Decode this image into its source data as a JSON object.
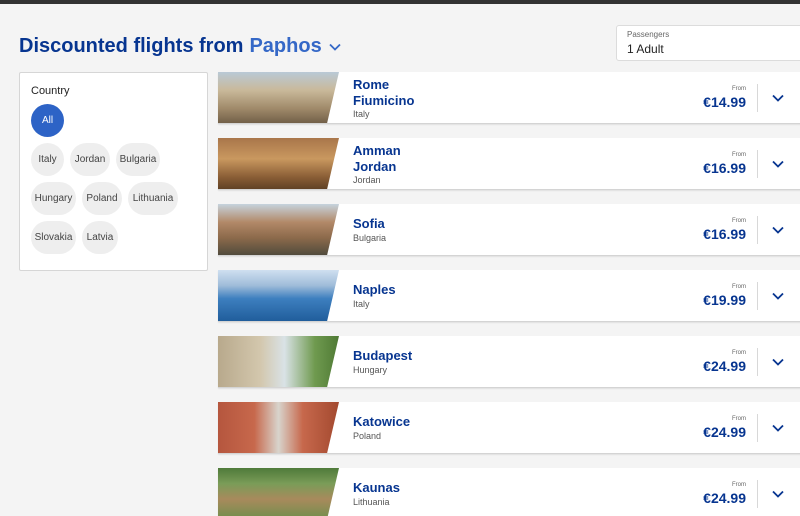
{
  "header": {
    "title": "Discounted flights from",
    "origin": "Paphos"
  },
  "passengers": {
    "label": "Passengers",
    "value": "1 Adult"
  },
  "filter": {
    "heading": "Country",
    "chips": [
      "All",
      "Italy",
      "Jordan",
      "Bulgaria",
      "Hungary",
      "Poland",
      "Lithuania",
      "Slovakia",
      "Latvia"
    ],
    "selected": "All"
  },
  "destinations": [
    {
      "city_line1": "Rome",
      "city_line2": "Fiumicino",
      "country": "Italy",
      "from": "From",
      "price": "€14.99"
    },
    {
      "city_line1": "Amman",
      "city_line2": "Jordan",
      "country": "Jordan",
      "from": "From",
      "price": "€16.99"
    },
    {
      "city_line1": "Sofia",
      "city_line2": "",
      "country": "Bulgaria",
      "from": "From",
      "price": "€16.99"
    },
    {
      "city_line1": "Naples",
      "city_line2": "",
      "country": "Italy",
      "from": "From",
      "price": "€19.99"
    },
    {
      "city_line1": "Budapest",
      "city_line2": "",
      "country": "Hungary",
      "from": "From",
      "price": "€24.99"
    },
    {
      "city_line1": "Katowice",
      "city_line2": "",
      "country": "Poland",
      "from": "From",
      "price": "€24.99"
    },
    {
      "city_line1": "Kaunas",
      "city_line2": "",
      "country": "Lithuania",
      "from": "From",
      "price": "€24.99"
    }
  ],
  "icons": {
    "origin_dropdown": "chevron-down-icon",
    "card_expand": "chevron-down-icon"
  },
  "colors": {
    "brand_dark": "#073590",
    "brand_accent": "#3568c7",
    "chip_active": "#2d63c6"
  }
}
